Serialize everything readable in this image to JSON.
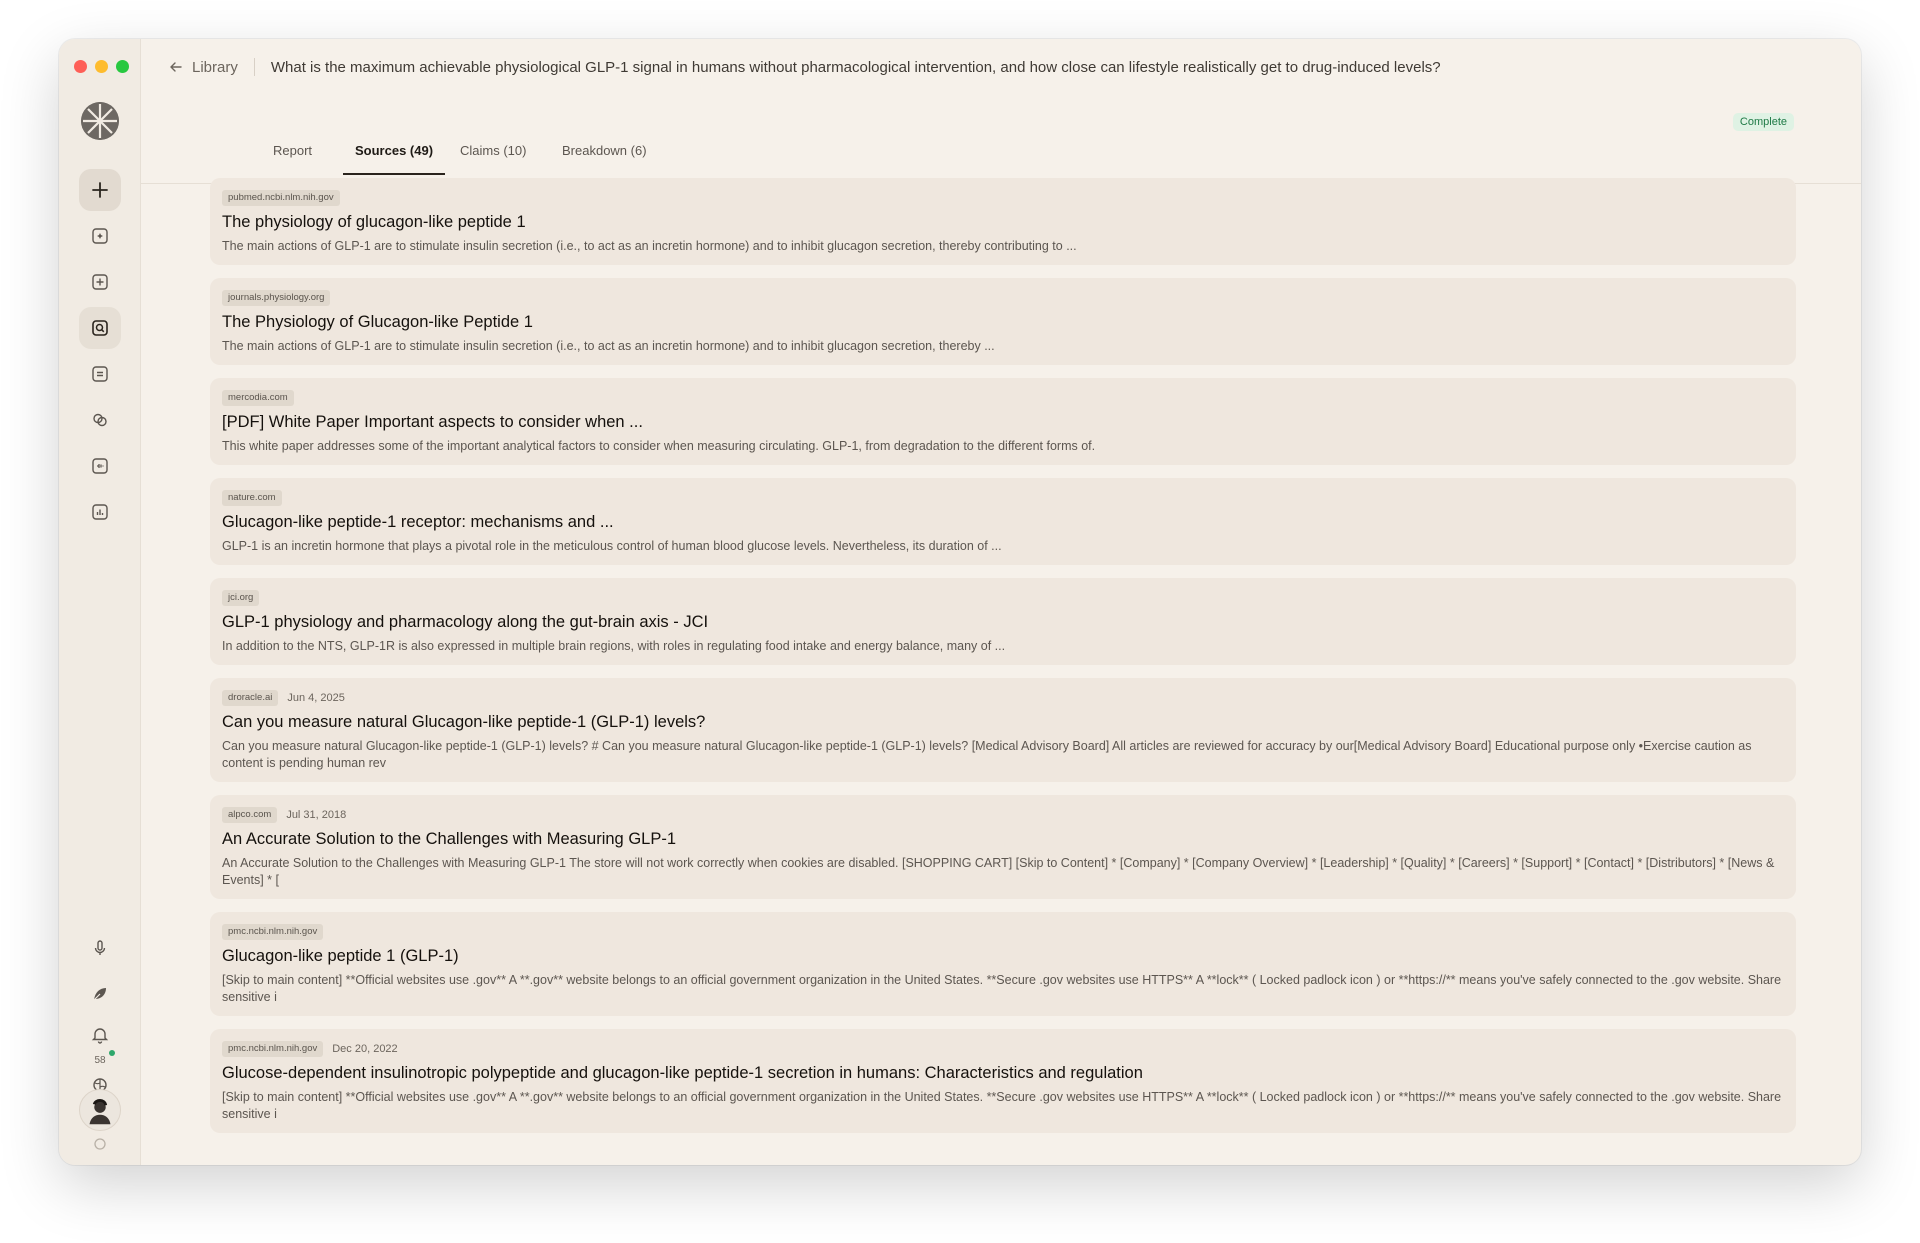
{
  "header": {
    "back_label": "Library",
    "query": "What is the maximum achievable physiological GLP-1 signal in humans without pharmacological intervention, and how close can lifestyle realistically get to drug-induced levels?"
  },
  "tabs": [
    {
      "label": "Report"
    },
    {
      "label": "Sources (49)"
    },
    {
      "label": "Claims (10)"
    },
    {
      "label": "Breakdown (6)"
    }
  ],
  "status": "Complete",
  "sidebar": {
    "notification_count": "58"
  },
  "sources": [
    {
      "domain": "pubmed.ncbi.nlm.nih.gov",
      "date": "",
      "title": "The physiology of glucagon-like peptide 1",
      "snippet": "The main actions of GLP-1 are to stimulate insulin secretion (i.e., to act as an incretin hormone) and to inhibit glucagon secretion, thereby contributing to ..."
    },
    {
      "domain": "journals.physiology.org",
      "date": "",
      "title": "The Physiology of Glucagon-like Peptide 1",
      "snippet": "The main actions of GLP-1 are to stimulate insulin secretion (i.e., to act as an incretin hormone) and to inhibit glucagon secretion, thereby ..."
    },
    {
      "domain": "mercodia.com",
      "date": "",
      "title": "[PDF] White Paper Important aspects to consider when ...",
      "snippet": "This white paper addresses some of the important analytical factors to consider when measuring circulating. GLP-1, from degradation to the different forms of."
    },
    {
      "domain": "nature.com",
      "date": "",
      "title": "Glucagon-like peptide-1 receptor: mechanisms and ...",
      "snippet": "GLP-1 is an incretin hormone that plays a pivotal role in the meticulous control of human blood glucose levels. Nevertheless, its duration of ..."
    },
    {
      "domain": "jci.org",
      "date": "",
      "title": "GLP-1 physiology and pharmacology along the gut-brain axis - JCI",
      "snippet": "In addition to the NTS, GLP-1R is also expressed in multiple brain regions, with roles in regulating food intake and energy balance, many of ..."
    },
    {
      "domain": "droracle.ai",
      "date": "Jun 4, 2025",
      "title": "Can you measure natural Glucagon-like peptide-1 (GLP-1) levels?",
      "snippet": "Can you measure natural Glucagon-like peptide-1 (GLP-1) levels? # Can you measure natural Glucagon-like peptide-1 (GLP-1) levels? [Medical Advisory Board] All articles are reviewed for accuracy by our[Medical Advisory Board] Educational purpose only •Exercise caution as content is pending human rev"
    },
    {
      "domain": "alpco.com",
      "date": "Jul 31, 2018",
      "title": "An Accurate Solution to the Challenges with Measuring GLP-1",
      "snippet": "An Accurate Solution to the Challenges with Measuring GLP-1 The store will not work correctly when cookies are disabled. [SHOPPING CART] [Skip to Content] * [Company] * [Company Overview] * [Leadership] * [Quality] * [Careers] * [Support] * [Contact] * [Distributors] * [News & Events] * ["
    },
    {
      "domain": "pmc.ncbi.nlm.nih.gov",
      "date": "",
      "title": "Glucagon-like peptide 1 (GLP-1)",
      "snippet": "[Skip to main content] **Official websites use .gov** A **.gov** website belongs to an official government organization in the United States. **Secure .gov websites use HTTPS** A **lock** ( Locked padlock icon ) or **https://** means you've safely connected to the .gov website. Share sensitive i"
    },
    {
      "domain": "pmc.ncbi.nlm.nih.gov",
      "date": "Dec 20, 2022",
      "title": "Glucose-dependent insulinotropic polypeptide and glucagon-like peptide-1 secretion in humans: Characteristics and regulation",
      "snippet": "[Skip to main content] **Official websites use .gov** A **.gov** website belongs to an official government organization in the United States. **Secure .gov websites use HTTPS** A **lock** ( Locked padlock icon ) or **https://** means you've safely connected to the .gov website. Share sensitive i"
    }
  ]
}
